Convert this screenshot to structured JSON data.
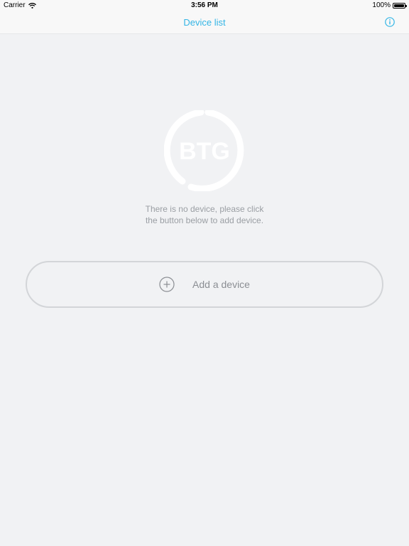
{
  "status_bar": {
    "carrier": "Carrier",
    "time": "3:56 PM",
    "battery": "100%",
    "battery_level": 1.0
  },
  "nav": {
    "title": "Device list",
    "info_icon": "info-icon"
  },
  "logo": {
    "text": "BTG",
    "icon": "btg-logo"
  },
  "empty_state": {
    "line1": "There is no device, please click",
    "line2": "the button below to add device."
  },
  "add_button": {
    "label": "Add a device",
    "icon": "plus-circle-icon"
  },
  "colors": {
    "accent": "#33b5e5",
    "background": "#f1f2f4",
    "bar": "#f8f8f8",
    "muted_text": "#9a9ea3"
  }
}
